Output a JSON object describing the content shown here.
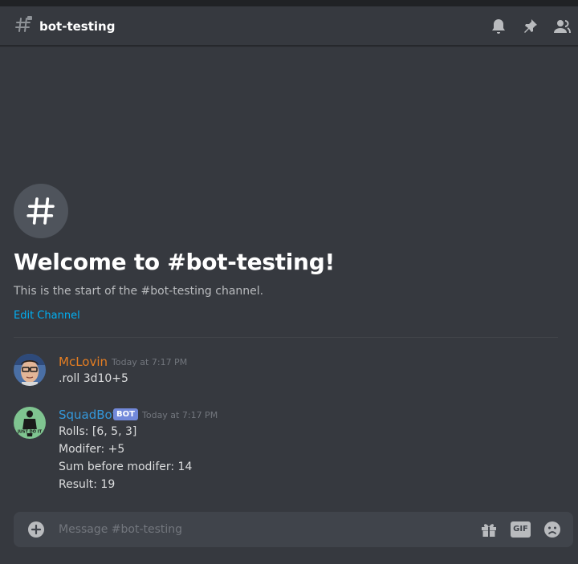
{
  "header": {
    "channel_name": "bot-testing",
    "icons": [
      "channel-hash-icon",
      "bell-icon",
      "pin-icon",
      "members-icon"
    ]
  },
  "welcome": {
    "title": "Welcome to #bot-testing!",
    "subtitle": "This is the start of the #bot-testing channel.",
    "edit_label": "Edit Channel"
  },
  "messages": [
    {
      "author": "McLovin",
      "author_color": "#e67e22",
      "timestamp": "Today at 7:17 PM",
      "lines": [
        ".roll 3d10+5"
      ]
    },
    {
      "author": "SquadBot",
      "author_color": "#3498db",
      "tag": "BOT",
      "timestamp": "Today at 7:17 PM",
      "lines": [
        "Rolls: [6, 5, 3]",
        "Modifer: +5",
        "Sum before modifer: 14",
        "Result: 19"
      ]
    }
  ],
  "composer": {
    "placeholder": "Message #bot-testing",
    "gif_label": "GIF",
    "icons": [
      "add-attachment-icon",
      "gift-icon",
      "gif-icon",
      "emoji-icon"
    ]
  },
  "colors": {
    "background": "#36393f",
    "link": "#00b0f4",
    "bot_tag": "#7289da",
    "composer": "#40444b"
  }
}
